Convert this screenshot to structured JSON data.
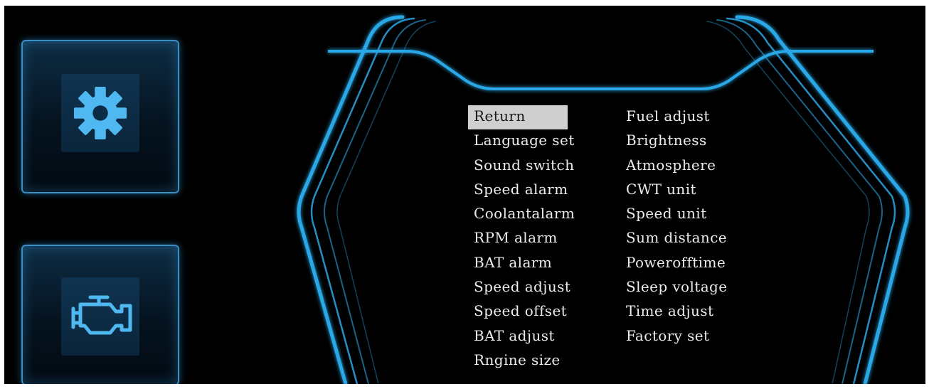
{
  "sidebar": {
    "tiles": [
      {
        "name": "settings",
        "icon": "gear-icon"
      },
      {
        "name": "engine",
        "icon": "engine-warning-icon"
      }
    ]
  },
  "colors": {
    "accent": "#2aa7e6",
    "icon": "#4fb8f0",
    "background": "#000000",
    "selected_bg": "#cfcfcf"
  },
  "menu": {
    "selected_index": 0,
    "left": [
      "Return",
      "Language set",
      "Sound switch",
      "Speed alarm",
      "Coolantalarm",
      "RPM alarm",
      "BAT alarm",
      "Speed adjust",
      "Speed offset",
      "BAT adjust",
      "Rngine size"
    ],
    "right": [
      "Fuel adjust",
      "Brightness",
      "Atmosphere",
      "CWT unit",
      "Speed unit",
      "Sum distance",
      "Powerofftime",
      "Sleep voltage",
      "Time adjust",
      "Factory set"
    ]
  }
}
